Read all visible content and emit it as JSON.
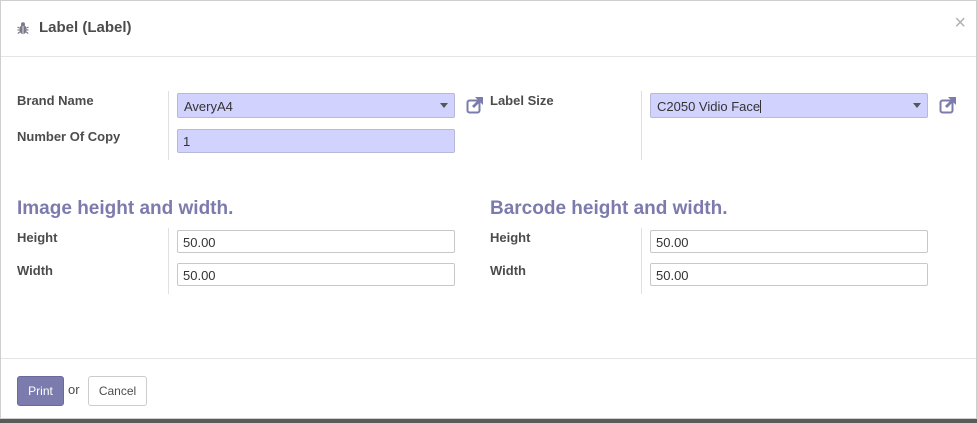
{
  "dialog": {
    "title": "Label (Label)",
    "close_symbol": "×"
  },
  "form": {
    "brand_name_label": "Brand Name",
    "brand_name_value": "AveryA4",
    "number_of_copy_label": "Number Of Copy",
    "number_of_copy_value": "1",
    "label_size_label": "Label Size",
    "label_size_value": "C2050 Vidio Face"
  },
  "image_section": {
    "title": "Image height and width.",
    "height_label": "Height",
    "height_value": "50.00",
    "width_label": "Width",
    "width_value": "50.00"
  },
  "barcode_section": {
    "title": "Barcode height and width.",
    "height_label": "Height",
    "height_value": "50.00",
    "width_label": "Width",
    "width_value": "50.00"
  },
  "footer": {
    "print_label": "Print",
    "or_label": "or",
    "cancel_label": "Cancel"
  },
  "colors": {
    "primary": "#7c7bad",
    "required_field_bg": "#d2d2ff"
  },
  "icons": {
    "title_icon": "bug-icon",
    "external_link": "external-link-icon"
  }
}
